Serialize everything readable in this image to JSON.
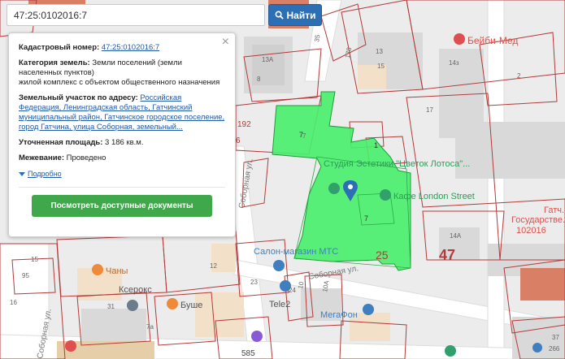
{
  "search": {
    "value": "47:25:0102016:7",
    "button_label": "Найти"
  },
  "popup": {
    "cadastral_label": "Кадастровый номер:",
    "cadastral_value": "47:25:0102016:7",
    "category_label": "Категория земель:",
    "category_value": "Земли поселений (земли населенных пунктов)",
    "use_value": "жилой комплекс с объектом общественного назначения",
    "address_label": "Земельный участок по адресу:",
    "address_value": "Российская Федерация, Ленинградская область, Гатчинский муниципальный район, Гатчинское городское поселение, город Гатчина, улица Соборная, земельный...",
    "area_label": "Уточненная площадь:",
    "area_value": "3 186 кв.м.",
    "survey_label": "Межевание:",
    "survey_value": "Проведено",
    "more_label": "Подробно",
    "docs_button": "Посмотреть доступные документы"
  },
  "map": {
    "street_labels": [
      "Соборная ул.",
      "Соборная ул.",
      "Соборная ул."
    ],
    "places": [
      {
        "name": "Бейби-Мед"
      },
      {
        "name": "Студия Эстетики \"Цветок Лотоса\"..."
      },
      {
        "name": "Кафе London Street"
      },
      {
        "name": "Салон-магазин МТС"
      },
      {
        "name": "Ксерокс"
      },
      {
        "name": "Буше"
      },
      {
        "name": "Tele2"
      },
      {
        "name": "МегаФон"
      },
      {
        "name": "Чаны"
      },
      {
        "name": "Гатч..."
      },
      {
        "name": "Государстве..."
      }
    ],
    "block_numbers": [
      "47",
      "25",
      "192",
      "6"
    ],
    "parcel_numbers": [
      "7",
      "1",
      "7",
      "102016"
    ],
    "house_numbers": [
      "35",
      "178",
      "13А",
      "8",
      "13",
      "15",
      "14з",
      "2",
      "17",
      "7",
      "14А",
      "12",
      "23",
      "24",
      "10",
      "10А",
      "31",
      "7а",
      "95",
      "15",
      "585",
      "37",
      "266",
      "16"
    ],
    "colors": {
      "selected_parcel": "#48f06c",
      "parcel_border": "#b33a3a",
      "block_number": "#b33a3a",
      "building": "#d7d7d7",
      "road": "#ffffff",
      "poi_blue": "#3f7fbf",
      "poi_orange": "#f08a3b",
      "poi_purple": "#8a5ad6",
      "poi_red": "#e04f4f",
      "marker": "#2d6fb4"
    }
  }
}
